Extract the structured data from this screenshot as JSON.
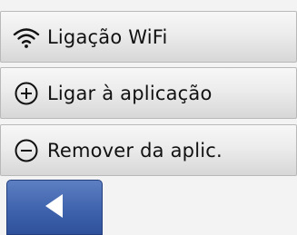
{
  "menu": {
    "items": [
      {
        "label": "Ligação WiFi",
        "icon": "wifi-icon"
      },
      {
        "label": "Ligar à aplicação",
        "icon": "plus-circle-icon"
      },
      {
        "label": "Remover da aplic.",
        "icon": "minus-circle-icon"
      }
    ]
  },
  "footer": {
    "back_icon": "back-arrow-icon"
  },
  "colors": {
    "menu_background": "#e6e6e6",
    "menu_border": "#b9b9b9",
    "back_button": "#3f63ad",
    "page_background": "#f3f3f3"
  }
}
